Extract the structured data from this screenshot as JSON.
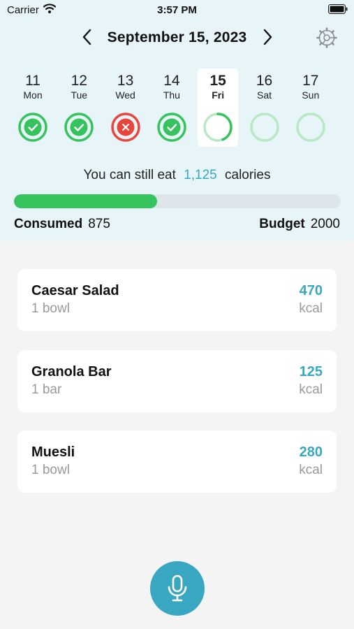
{
  "status_bar": {
    "carrier": "Carrier",
    "time": "3:57 PM"
  },
  "header": {
    "date_title": "September 15, 2023",
    "prev_icon": "chevron-left-icon",
    "next_icon": "chevron-right-icon",
    "settings_icon": "gear-icon"
  },
  "week": [
    {
      "num": "11",
      "name": "Mon",
      "status": "complete"
    },
    {
      "num": "12",
      "name": "Tue",
      "status": "complete"
    },
    {
      "num": "13",
      "name": "Wed",
      "status": "over"
    },
    {
      "num": "14",
      "name": "Thu",
      "status": "complete"
    },
    {
      "num": "15",
      "name": "Fri",
      "status": "in-progress",
      "selected": true,
      "progress": 0.44
    },
    {
      "num": "16",
      "name": "Sat",
      "status": "empty"
    },
    {
      "num": "17",
      "name": "Sun",
      "status": "empty"
    }
  ],
  "summary": {
    "prefix": "You can still eat",
    "remaining": "1,125",
    "suffix": "calories",
    "consumed_label": "Consumed",
    "consumed_value": "875",
    "budget_label": "Budget",
    "budget_value": "2000",
    "progress_fraction": 0.4375
  },
  "foods": [
    {
      "name": "Caesar Salad",
      "qty": "1 bowl",
      "kcal": "470",
      "unit": "kcal"
    },
    {
      "name": "Granola Bar",
      "qty": "1 bar",
      "kcal": "125",
      "unit": "kcal"
    },
    {
      "name": "Muesli",
      "qty": "1 bowl",
      "kcal": "280",
      "unit": "kcal"
    }
  ],
  "colors": {
    "accent": "#3aa7c2",
    "success": "#36c35d",
    "danger": "#e8453c",
    "ring_empty": "#b8e8c4"
  },
  "mic_icon": "microphone-icon"
}
